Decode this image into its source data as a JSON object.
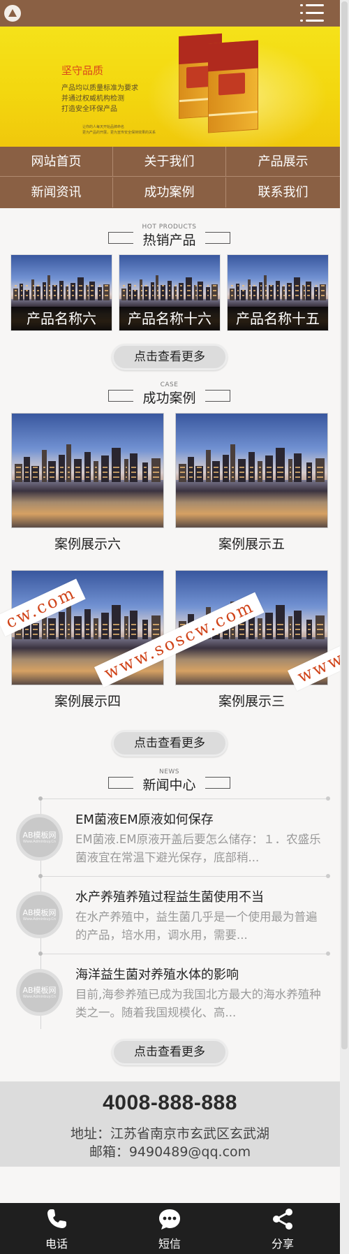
{
  "header": {
    "logo_icon": "logo-icon",
    "menu_icon": "hamburger-menu-icon"
  },
  "banner": {
    "title": "坚守品质",
    "lines": [
      "产品均以质量标准为要求",
      "并通过权威机构检测",
      "打造安全环保产品"
    ],
    "small_lines": [
      "让你的人每天开始品牌命名",
      "更为产品的开展，更为宣传安全保持效果的关系"
    ]
  },
  "nav": {
    "items": [
      "网站首页",
      "关于我们",
      "产品展示",
      "新闻资讯",
      "成功案例",
      "联系我们"
    ]
  },
  "hot_products": {
    "title_en": "HOT PRODUCTS",
    "title_cn": "热销产品",
    "items": [
      "产品名称六",
      "产品名称十六",
      "产品名称十五"
    ],
    "more": "点击查看更多"
  },
  "cases": {
    "title_en": "CASE",
    "title_cn": "成功案例",
    "items": [
      "案例展示六",
      "案例展示五",
      "案例展示四",
      "案例展示三"
    ],
    "more": "点击查看更多"
  },
  "watermarks": [
    "cw.com",
    "www.soscw.com",
    "www.s"
  ],
  "news": {
    "title_en": "NEWS",
    "title_cn": "新闻中心",
    "avatar_text": "AB模板网",
    "avatar_sub": "Www.Adminbuy.Cn",
    "items": [
      {
        "title": "EM菌液EM原液如何保存",
        "desc": "EM菌液.EM原液开盖后要怎么储存：１．农盛乐菌液宜在常温下避光保存，底部稍..."
      },
      {
        "title": "水产养殖养殖过程益生菌使用不当",
        "desc": "在水产养殖中，益生菌几乎是一个使用最为普遍的产品，培水用，调水用，需要..."
      },
      {
        "title": "海洋益生菌对养殖水体的影响",
        "desc": "目前,海参养殖已成为我国北方最大的海水养殖种类之一。随着我国规模化、高..."
      }
    ],
    "more": "点击查看更多"
  },
  "contact": {
    "phone": "4008-888-888",
    "address": "地址：江苏省南京市玄武区玄武湖",
    "email": "邮箱：9490489@qq.com"
  },
  "bottom_bar": {
    "items": [
      {
        "label": "电话",
        "icon": "phone-icon"
      },
      {
        "label": "短信",
        "icon": "message-icon"
      },
      {
        "label": "分享",
        "icon": "share-icon"
      }
    ]
  }
}
